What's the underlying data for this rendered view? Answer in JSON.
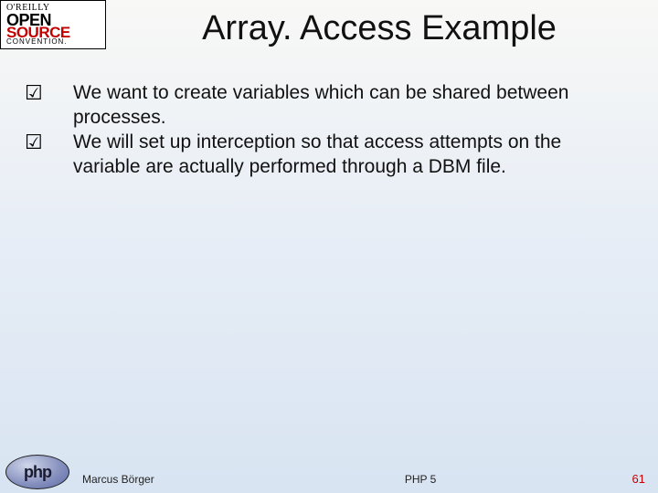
{
  "logo": {
    "oreilly": "O'REILLY",
    "open": "OPEN",
    "source": "SOURCE",
    "convention": "CONVENTION."
  },
  "php_logo_text": "php",
  "title": "Array. Access Example",
  "bullets": [
    "We want to create variables which can be shared between processes.",
    "We will set up interception so that access attempts on the variable are actually performed through a DBM file."
  ],
  "footer": {
    "author": "Marcus Börger",
    "center": "PHP 5",
    "page": "61"
  }
}
